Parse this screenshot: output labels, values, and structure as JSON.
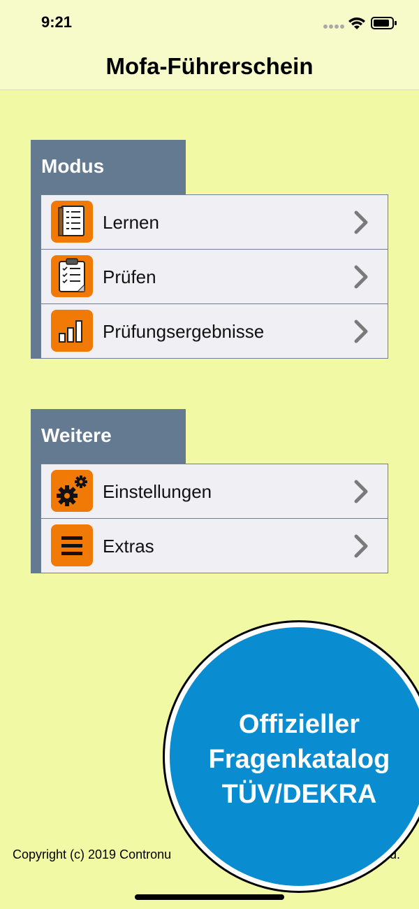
{
  "status_bar": {
    "time": "9:21"
  },
  "nav": {
    "title": "Mofa-Führerschein"
  },
  "sections": [
    {
      "title": "Modus",
      "rows": [
        {
          "label": "Lernen",
          "icon": "notebook-icon"
        },
        {
          "label": "Prüfen",
          "icon": "clipboard-checklist-icon"
        },
        {
          "label": "Prüfungsergebnisse",
          "icon": "bar-chart-icon"
        }
      ]
    },
    {
      "title": "Weitere",
      "rows": [
        {
          "label": "Einstellungen",
          "icon": "gears-icon"
        },
        {
          "label": "Extras",
          "icon": "menu-lines-icon"
        }
      ]
    }
  ],
  "badge": {
    "line1": "Offizieller",
    "line2": "Fragenkatalog",
    "line3": "TÜV/DEKRA"
  },
  "footer": {
    "copyright": "Copyright (c) 2019 Contronu",
    "copyright_end": "ed."
  },
  "colors": {
    "background": "#f2f9a4",
    "header": "#647a91",
    "row": "#efeff4",
    "icon_orange": "#f07a05",
    "badge_blue": "#0a8cd0"
  }
}
